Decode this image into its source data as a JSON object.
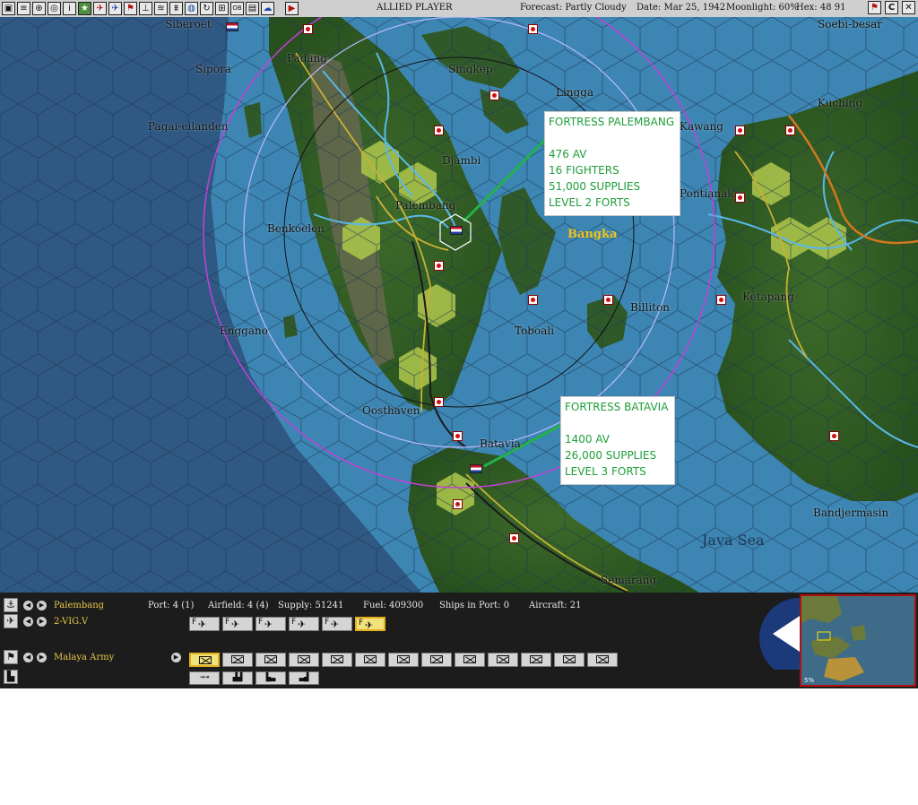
{
  "toolbar": {
    "buttons": [
      "map-view",
      "reports",
      "aircraft",
      "ships",
      "intel",
      "medals",
      "air-ops",
      "air-unit",
      "flag",
      "recon",
      "subs",
      "convoy",
      "globe",
      "cycle",
      "info",
      "ob",
      "grid",
      "cloud"
    ],
    "player_label": "ALLIED PLAYER",
    "forecast": "Forecast: Partly Cloudy",
    "date": "Date: Mar 25, 1942",
    "moonlight": "Moonlight: 60%",
    "hex": "Hex: 48 91",
    "right_buttons": [
      "end-turn-flag",
      "C",
      "close"
    ]
  },
  "map": {
    "places": [
      {
        "name": "Siberoet"
      },
      {
        "name": "Soebi-besar"
      },
      {
        "name": "Padang"
      },
      {
        "name": "Sipora"
      },
      {
        "name": "Singkep"
      },
      {
        "name": "Lingga"
      },
      {
        "name": "Kuching"
      },
      {
        "name": "Pagai-eilanden"
      },
      {
        "name": "Kawang"
      },
      {
        "name": "Djambi"
      },
      {
        "name": "Pontianak"
      },
      {
        "name": "Palembang"
      },
      {
        "name": "Benkoelen"
      },
      {
        "name": "Ketapang"
      },
      {
        "name": "Billiton"
      },
      {
        "name": "Enggano"
      },
      {
        "name": "Toboali"
      },
      {
        "name": "Oosthaven"
      },
      {
        "name": "Batavia"
      },
      {
        "name": "Bandjermasin"
      },
      {
        "name": "Semarang"
      }
    ],
    "region_label": "Bangka",
    "sea_label": "Java Sea"
  },
  "callouts": [
    {
      "title": "FORTRESS PALEMBANG",
      "lines": [
        "476 AV",
        "16 FIGHTERS",
        "51,000 SUPPLIES",
        "LEVEL 2 FORTS"
      ]
    },
    {
      "title": "FORTRESS BATAVIA",
      "lines": [
        "1400 AV",
        "26,000 SUPPLIES",
        "LEVEL 3 FORTS"
      ]
    }
  ],
  "panel": {
    "base_name": "Palembang",
    "port": "Port: 4 (1)",
    "airfield": "Airfield: 4 (4)",
    "supply": "Supply: 51241",
    "fuel": "Fuel: 409300",
    "ships_in_port": "Ships in Port: 0",
    "aircraft": "Aircraft: 21",
    "air_unit": "2-VIG.V",
    "air_unit_buttons": [
      "F",
      "F",
      "F",
      "F",
      "F",
      "F"
    ],
    "hq_name": "Malaya Army",
    "unit_button_count": 13,
    "tool_buttons": [
      "rail",
      "industry",
      "factory",
      "resources"
    ],
    "minimap_zoom": "5%"
  }
}
